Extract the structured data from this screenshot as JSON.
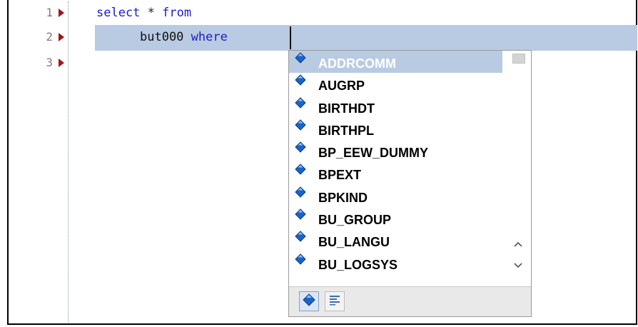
{
  "editor": {
    "lines": [
      {
        "number": "1",
        "tokens": [
          {
            "text": "select",
            "kind": "kw"
          },
          {
            "text": " * ",
            "kind": "op"
          },
          {
            "text": "from",
            "kind": "kw"
          }
        ]
      },
      {
        "number": "2",
        "tokens": [
          {
            "text": "but000",
            "kind": "ident"
          },
          {
            "text": " where",
            "kind": "kw"
          }
        ]
      },
      {
        "number": "3",
        "tokens": []
      }
    ],
    "colors": {
      "keyword": "#1c1cc8",
      "current_line": "#b9cbe3",
      "marker": "#a31515",
      "line_number": "#7f7f7f"
    }
  },
  "autocomplete": {
    "selected_index": 0,
    "items": [
      {
        "label": "ADDRCOMM",
        "icon": "field-diamond-icon"
      },
      {
        "label": "AUGRP",
        "icon": "field-diamond-icon"
      },
      {
        "label": "BIRTHDT",
        "icon": "field-diamond-icon"
      },
      {
        "label": "BIRTHPL",
        "icon": "field-diamond-icon"
      },
      {
        "label": "BP_EEW_DUMMY",
        "icon": "field-diamond-icon"
      },
      {
        "label": "BPEXT",
        "icon": "field-diamond-icon"
      },
      {
        "label": "BPKIND",
        "icon": "field-diamond-icon"
      },
      {
        "label": "BU_GROUP",
        "icon": "field-diamond-icon"
      },
      {
        "label": "BU_LANGU",
        "icon": "field-diamond-icon"
      },
      {
        "label": "BU_LOGSYS",
        "icon": "field-diamond-icon"
      }
    ],
    "scroll": {
      "up_icon": "chevron-up-icon",
      "down_icon": "chevron-down-icon"
    },
    "footer_filters": [
      {
        "name": "fields-filter",
        "icon": "field-diamond-icon",
        "active": true
      },
      {
        "name": "text-filter",
        "icon": "lines-icon",
        "active": false
      }
    ]
  }
}
